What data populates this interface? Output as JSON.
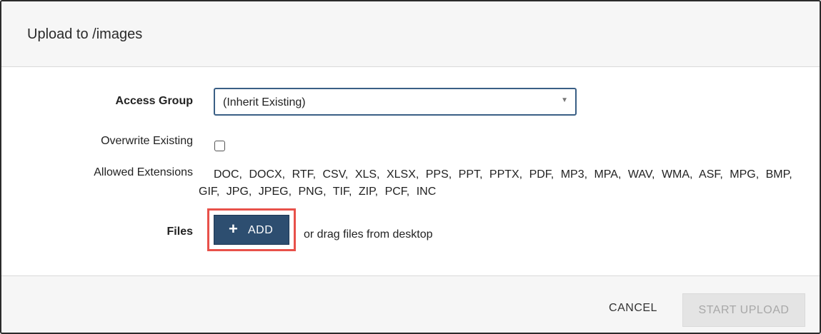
{
  "dialog": {
    "title": "Upload to /images"
  },
  "form": {
    "access_group": {
      "label": "Access Group",
      "selected": "(Inherit Existing)"
    },
    "overwrite": {
      "label": "Overwrite Existing",
      "checked": false
    },
    "extensions": {
      "label": "Allowed Extensions",
      "value": "DOC, DOCX, RTF, CSV, XLS, XLSX, PPS, PPT, PPTX, PDF, MP3, MPA, WAV, WMA, ASF, MPG, BMP, GIF, JPG, JPEG, PNG, TIF, ZIP, PCF, INC"
    },
    "files": {
      "label": "Files",
      "add_label": "ADD",
      "drag_hint": "or drag files from desktop"
    }
  },
  "footer": {
    "cancel_label": "CANCEL",
    "start_label": "START UPLOAD"
  },
  "colors": {
    "primary_button": "#2d4e70",
    "highlight_outline": "#e8514a",
    "disabled_button": "#e4e4e4"
  },
  "icons": {
    "add": "plus-icon",
    "select_caret": "caret-down-icon"
  }
}
